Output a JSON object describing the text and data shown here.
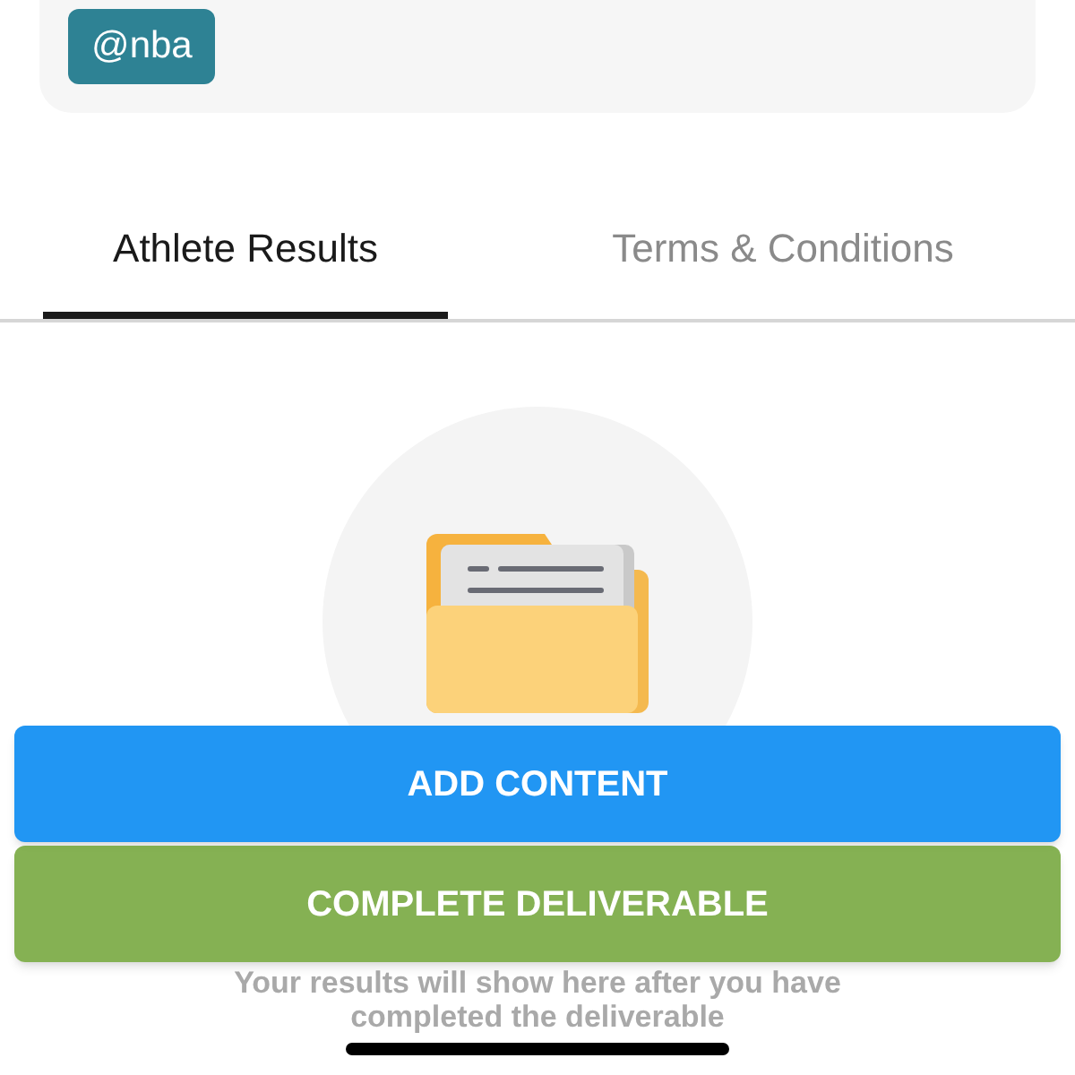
{
  "profile_card": {
    "tag": "@nba"
  },
  "tabs": [
    {
      "label": "Athlete Results",
      "selected": true
    },
    {
      "label": "Terms & Conditions",
      "selected": false
    }
  ],
  "empty_state": {
    "message": "Your results will show here after you have completed the deliverable"
  },
  "buttons": [
    {
      "label": "ADD CONTENT",
      "kind": "primary"
    },
    {
      "label": "COMPLETE DELIVERABLE",
      "kind": "success"
    }
  ]
}
